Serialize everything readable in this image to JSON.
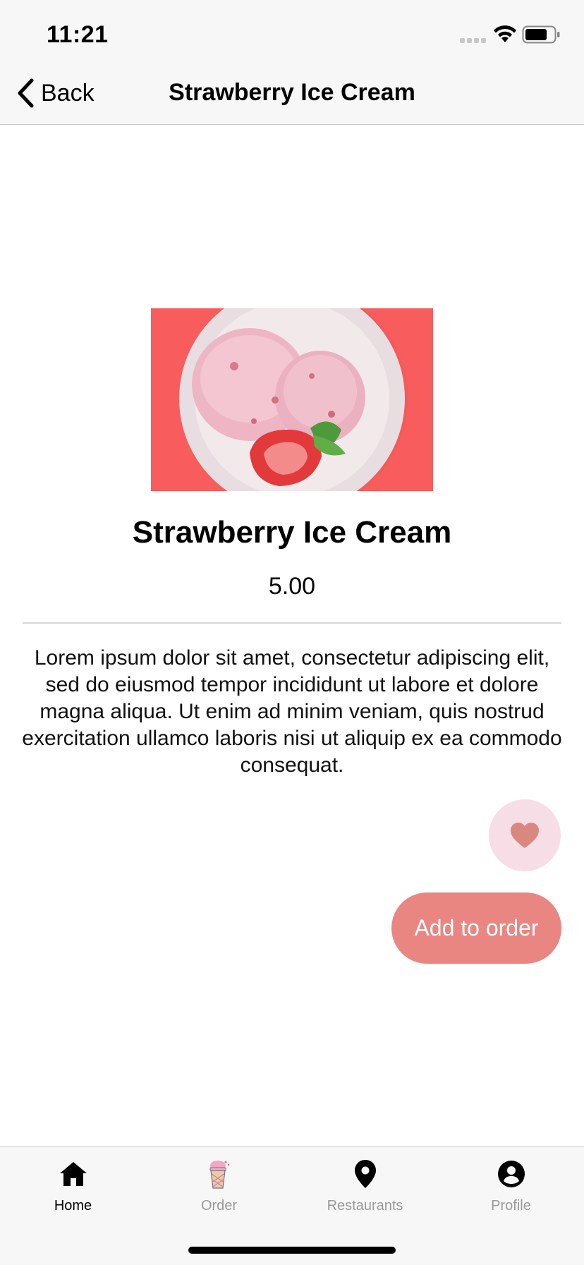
{
  "status_bar": {
    "time": "11:21"
  },
  "nav": {
    "back_label": "Back",
    "title": "Strawberry Ice Cream"
  },
  "product": {
    "title": "Strawberry Ice Cream",
    "price": "5.00",
    "description": "Lorem ipsum dolor sit amet, consectetur adipiscing elit, sed do eiusmod tempor incididunt ut labore et dolore magna aliqua. Ut enim ad minim veniam, quis nostrud exercitation ullamco laboris nisi ut aliquip ex ea commodo consequat.",
    "image_icon": "ice-cream-bowl-photo"
  },
  "actions": {
    "favorite_icon": "heart-icon",
    "add_to_order_label": "Add to order"
  },
  "tabs": [
    {
      "label": "Home",
      "icon": "home-icon",
      "active": true
    },
    {
      "label": "Order",
      "icon": "ice-cream-cup-icon",
      "active": false
    },
    {
      "label": "Restaurants",
      "icon": "map-pin-icon",
      "active": false
    },
    {
      "label": "Profile",
      "icon": "person-circle-icon",
      "active": false
    }
  ],
  "colors": {
    "accent": "#ea8682",
    "favorite_bg": "#f7dde6",
    "heart": "#d98880",
    "image_bg": "#f85c5c"
  }
}
